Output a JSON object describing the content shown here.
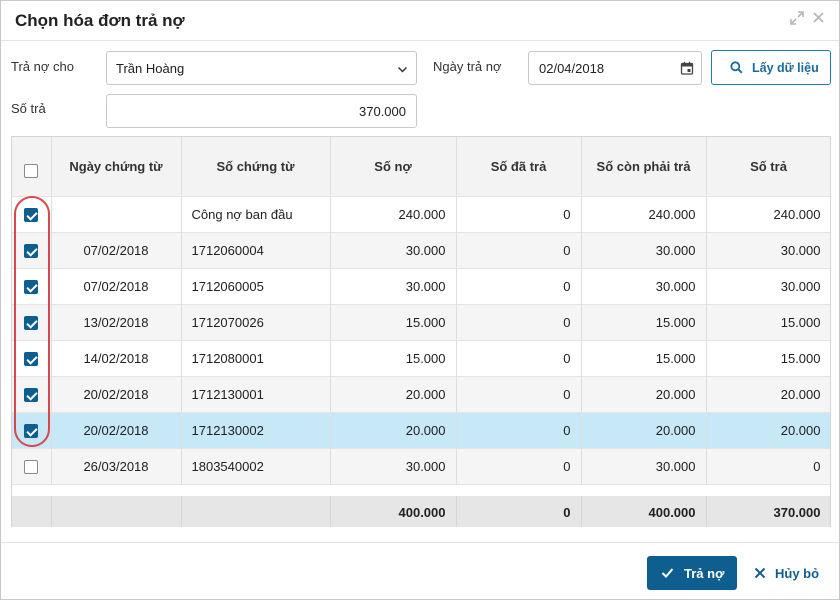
{
  "dialog": {
    "title": "Chọn hóa đơn trả nợ"
  },
  "form": {
    "payer_label": "Trả nợ cho",
    "payer_value": "Trần Hoàng",
    "date_label": "Ngày trả nợ",
    "date_value": "02/04/2018",
    "amount_label": "Số trả",
    "amount_value": "370.000",
    "fetch_label": "Lấy dữ liệu"
  },
  "grid": {
    "columns": [
      "Ngày chứng từ",
      "Số chứng từ",
      "Số nợ",
      "Số đã trả",
      "Số còn phải trả",
      "Số trả"
    ],
    "rows": [
      {
        "checked": true,
        "date": "",
        "doc_no": "Công nợ ban đầu",
        "debt": "240.000",
        "paid": "0",
        "remaining": "240.000",
        "pay": "240.000",
        "selected": false
      },
      {
        "checked": true,
        "date": "07/02/2018",
        "doc_no": "1712060004",
        "debt": "30.000",
        "paid": "0",
        "remaining": "30.000",
        "pay": "30.000",
        "selected": false
      },
      {
        "checked": true,
        "date": "07/02/2018",
        "doc_no": "1712060005",
        "debt": "30.000",
        "paid": "0",
        "remaining": "30.000",
        "pay": "30.000",
        "selected": false
      },
      {
        "checked": true,
        "date": "13/02/2018",
        "doc_no": "1712070026",
        "debt": "15.000",
        "paid": "0",
        "remaining": "15.000",
        "pay": "15.000",
        "selected": false
      },
      {
        "checked": true,
        "date": "14/02/2018",
        "doc_no": "1712080001",
        "debt": "15.000",
        "paid": "0",
        "remaining": "15.000",
        "pay": "15.000",
        "selected": false
      },
      {
        "checked": true,
        "date": "20/02/2018",
        "doc_no": "1712130001",
        "debt": "20.000",
        "paid": "0",
        "remaining": "20.000",
        "pay": "20.000",
        "selected": false
      },
      {
        "checked": true,
        "date": "20/02/2018",
        "doc_no": "1712130002",
        "debt": "20.000",
        "paid": "0",
        "remaining": "20.000",
        "pay": "20.000",
        "selected": true
      },
      {
        "checked": false,
        "date": "26/03/2018",
        "doc_no": "1803540002",
        "debt": "30.000",
        "paid": "0",
        "remaining": "30.000",
        "pay": "0",
        "selected": false
      }
    ],
    "totals": {
      "debt": "400.000",
      "paid": "0",
      "remaining": "400.000",
      "pay": "370.000"
    }
  },
  "footer": {
    "pay_label": "Trả nợ",
    "cancel_label": "Hủy bỏ"
  },
  "icons": {
    "expand": "expand-icon",
    "close": "close-icon",
    "dropdown": "chevron-down-icon",
    "calendar": "calendar-icon",
    "search": "search-icon",
    "check": "check-icon"
  },
  "colors": {
    "accent": "#0e5f8f",
    "selected_row": "#c6e8f7",
    "annotation": "#d8474d"
  }
}
